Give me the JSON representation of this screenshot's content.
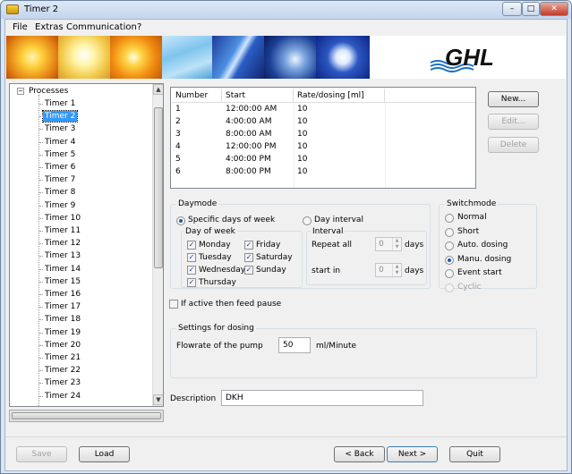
{
  "window": {
    "title": "Timer 2",
    "controls": [
      "–",
      "□",
      "✕"
    ]
  },
  "menu": [
    "File",
    "Extras",
    "Communication",
    "?"
  ],
  "logo_text": "GHL",
  "tree": {
    "root": "Processes",
    "items": [
      "Timer 1",
      "Timer 2",
      "Timer 3",
      "Timer 4",
      "Timer 5",
      "Timer 6",
      "Timer 7",
      "Timer 8",
      "Timer 9",
      "Timer 10",
      "Timer 11",
      "Timer 12",
      "Timer 13",
      "Timer 14",
      "Timer 15",
      "Timer 16",
      "Timer 17",
      "Timer 18",
      "Timer 19",
      "Timer 20",
      "Timer 21",
      "Timer 22",
      "Timer 23",
      "Timer 24"
    ],
    "selected": "Timer 2"
  },
  "grid": {
    "headers": [
      "Number",
      "Start",
      "Rate/dosing [ml]"
    ],
    "rows": [
      [
        "1",
        "12:00:00 AM",
        "10"
      ],
      [
        "2",
        "4:00:00 AM",
        "10"
      ],
      [
        "3",
        "8:00:00 AM",
        "10"
      ],
      [
        "4",
        "12:00:00 PM",
        "10"
      ],
      [
        "5",
        "4:00:00 PM",
        "10"
      ],
      [
        "6",
        "8:00:00 PM",
        "10"
      ]
    ]
  },
  "grid_buttons": {
    "new": "New...",
    "edit": "Edit...",
    "delete": "Delete"
  },
  "daymode": {
    "title": "Daymode",
    "specific": "Specific days of week",
    "interval": "Day interval",
    "day_of_week_title": "Day of week",
    "days": [
      "Monday",
      "Tuesday",
      "Wednesday",
      "Thursday",
      "Friday",
      "Saturday",
      "Sunday"
    ],
    "interval_title": "Interval",
    "repeat_all": "Repeat all",
    "start_in": "start in",
    "repeat_value": "0",
    "start_value": "0",
    "days_unit": "days"
  },
  "switchmode": {
    "title": "Switchmode",
    "options": [
      "Normal",
      "Short",
      "Auto. dosing",
      "Manu. dosing",
      "Event start",
      "Cyclic"
    ],
    "selected": "Manu. dosing"
  },
  "feed_pause": "If active then feed pause",
  "dosing": {
    "title": "Settings for dosing",
    "flowrate_label": "Flowrate of the pump",
    "flowrate_value": "50",
    "unit": "ml/Minute"
  },
  "description": {
    "label": "Description",
    "value": "DKH"
  },
  "footer": {
    "save": "Save",
    "load": "Load",
    "back": "< Back",
    "next": "Next >",
    "quit": "Quit"
  }
}
